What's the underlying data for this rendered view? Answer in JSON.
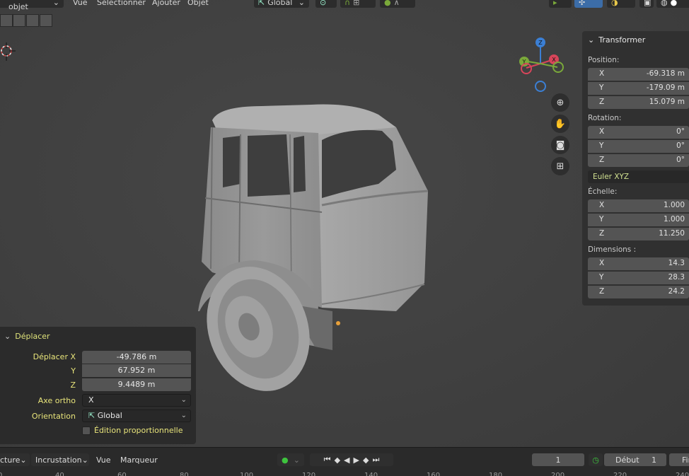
{
  "header": {
    "mode": "Mode objet",
    "menu": [
      "Vue",
      "Sélectionner",
      "Ajouter",
      "Objet"
    ],
    "orientation": "Global"
  },
  "npanel": {
    "title": "Transformer",
    "position_label": "Position:",
    "position": [
      {
        "axis": "X",
        "value": "-69.318 m"
      },
      {
        "axis": "Y",
        "value": "-179.09 m"
      },
      {
        "axis": "Z",
        "value": "15.079 m"
      }
    ],
    "rotation_label": "Rotation:",
    "rotation": [
      {
        "axis": "X",
        "value": "0°"
      },
      {
        "axis": "Y",
        "value": "0°"
      },
      {
        "axis": "Z",
        "value": "0°"
      }
    ],
    "rotation_mode": "Euler XYZ",
    "scale_label": "Échelle:",
    "scale": [
      {
        "axis": "X",
        "value": "1.000"
      },
      {
        "axis": "Y",
        "value": "1.000"
      },
      {
        "axis": "Z",
        "value": "11.250"
      }
    ],
    "dimensions_label": "Dimensions  :",
    "dimensions": [
      {
        "axis": "X",
        "value": "14.3"
      },
      {
        "axis": "Y",
        "value": "28.3"
      },
      {
        "axis": "Z",
        "value": "24.2"
      }
    ]
  },
  "operator": {
    "title": "Déplacer",
    "fields": [
      {
        "label": "Déplacer X",
        "value": "-49.786 m"
      },
      {
        "label": "Y",
        "value": "67.952 m"
      },
      {
        "label": "Z",
        "value": "9.4489 m"
      }
    ],
    "axis_label": "Axe ortho",
    "axis_value": "X",
    "orientation_label": "Orientation",
    "orientation_value": "Global",
    "proportional": "Édition proportionnelle"
  },
  "gizmo": {
    "x": "X",
    "y": "Y",
    "z": "Z"
  },
  "timeline": {
    "mode": "cture",
    "keying": "Incrustation",
    "menu": [
      "Vue",
      "Marqueur"
    ],
    "current_frame": "1",
    "start_label": "Début",
    "start_value": "1",
    "end_label": "Fin",
    "ruler": [
      "0",
      "40",
      "60",
      "80",
      "100",
      "120",
      "140",
      "160",
      "180",
      "200",
      "220",
      "240"
    ]
  },
  "colors": {
    "accent_yellow": "#e8e47a",
    "axis_x": "#d8455a",
    "axis_y": "#7aa93a",
    "axis_z": "#3b7fd4"
  }
}
